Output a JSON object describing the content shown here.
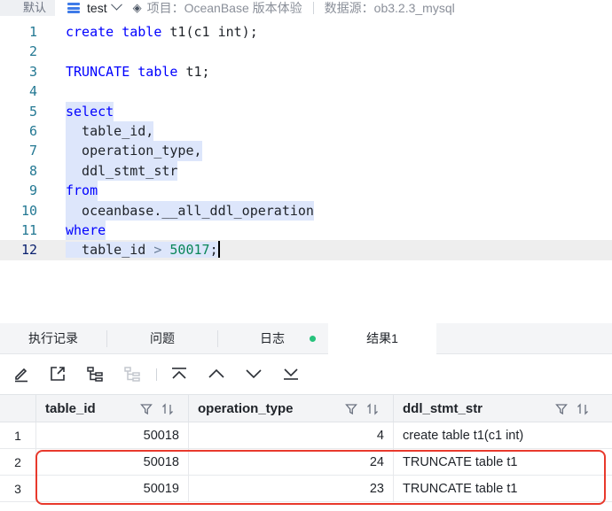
{
  "topbar": {
    "default_label": "默认",
    "database": "test",
    "project": "项目：OceanBase 版本体验",
    "datasource": "数据源：ob3.2.3_mysql"
  },
  "editor": {
    "lines": [
      {
        "n": "1",
        "t": "create table t1(c1 int);"
      },
      {
        "n": "2",
        "t": ""
      },
      {
        "n": "3",
        "t": "TRUNCATE table t1;"
      },
      {
        "n": "4",
        "t": ""
      },
      {
        "n": "5",
        "t": "select"
      },
      {
        "n": "6",
        "t": "  table_id,"
      },
      {
        "n": "7",
        "t": "  operation_type,"
      },
      {
        "n": "8",
        "t": "  ddl_stmt_str"
      },
      {
        "n": "9",
        "t": "from"
      },
      {
        "n": "10",
        "t": "  oceanbase.__all_ddl_operation"
      },
      {
        "n": "11",
        "t": "where"
      },
      {
        "n": "12",
        "t": "  table_id > 50017;"
      }
    ],
    "current_line": 12
  },
  "tabs": [
    {
      "label": "执行记录"
    },
    {
      "label": "问题"
    },
    {
      "label": "日志"
    },
    {
      "label": "结果1",
      "active": true
    }
  ],
  "toolbar": {
    "icons": [
      "edit-icon",
      "export-icon",
      "tree-icon",
      "tree-disabled-icon",
      "scroll-top-icon",
      "prev-icon",
      "next-icon",
      "scroll-bottom-icon"
    ]
  },
  "result": {
    "columns": [
      "table_id",
      "operation_type",
      "ddl_stmt_str"
    ],
    "rows": [
      {
        "idx": "1",
        "table_id": "50018",
        "operation_type": "4",
        "ddl_stmt_str": "create table t1(c1 int)"
      },
      {
        "idx": "2",
        "table_id": "50018",
        "operation_type": "24",
        "ddl_stmt_str": "TRUNCATE table t1"
      },
      {
        "idx": "3",
        "table_id": "50019",
        "operation_type": "23",
        "ddl_stmt_str": "TRUNCATE table t1"
      }
    ]
  },
  "colors": {
    "accent": "#3f7be8",
    "highlight": "#e8392c",
    "status_dot": "#27c27c"
  }
}
